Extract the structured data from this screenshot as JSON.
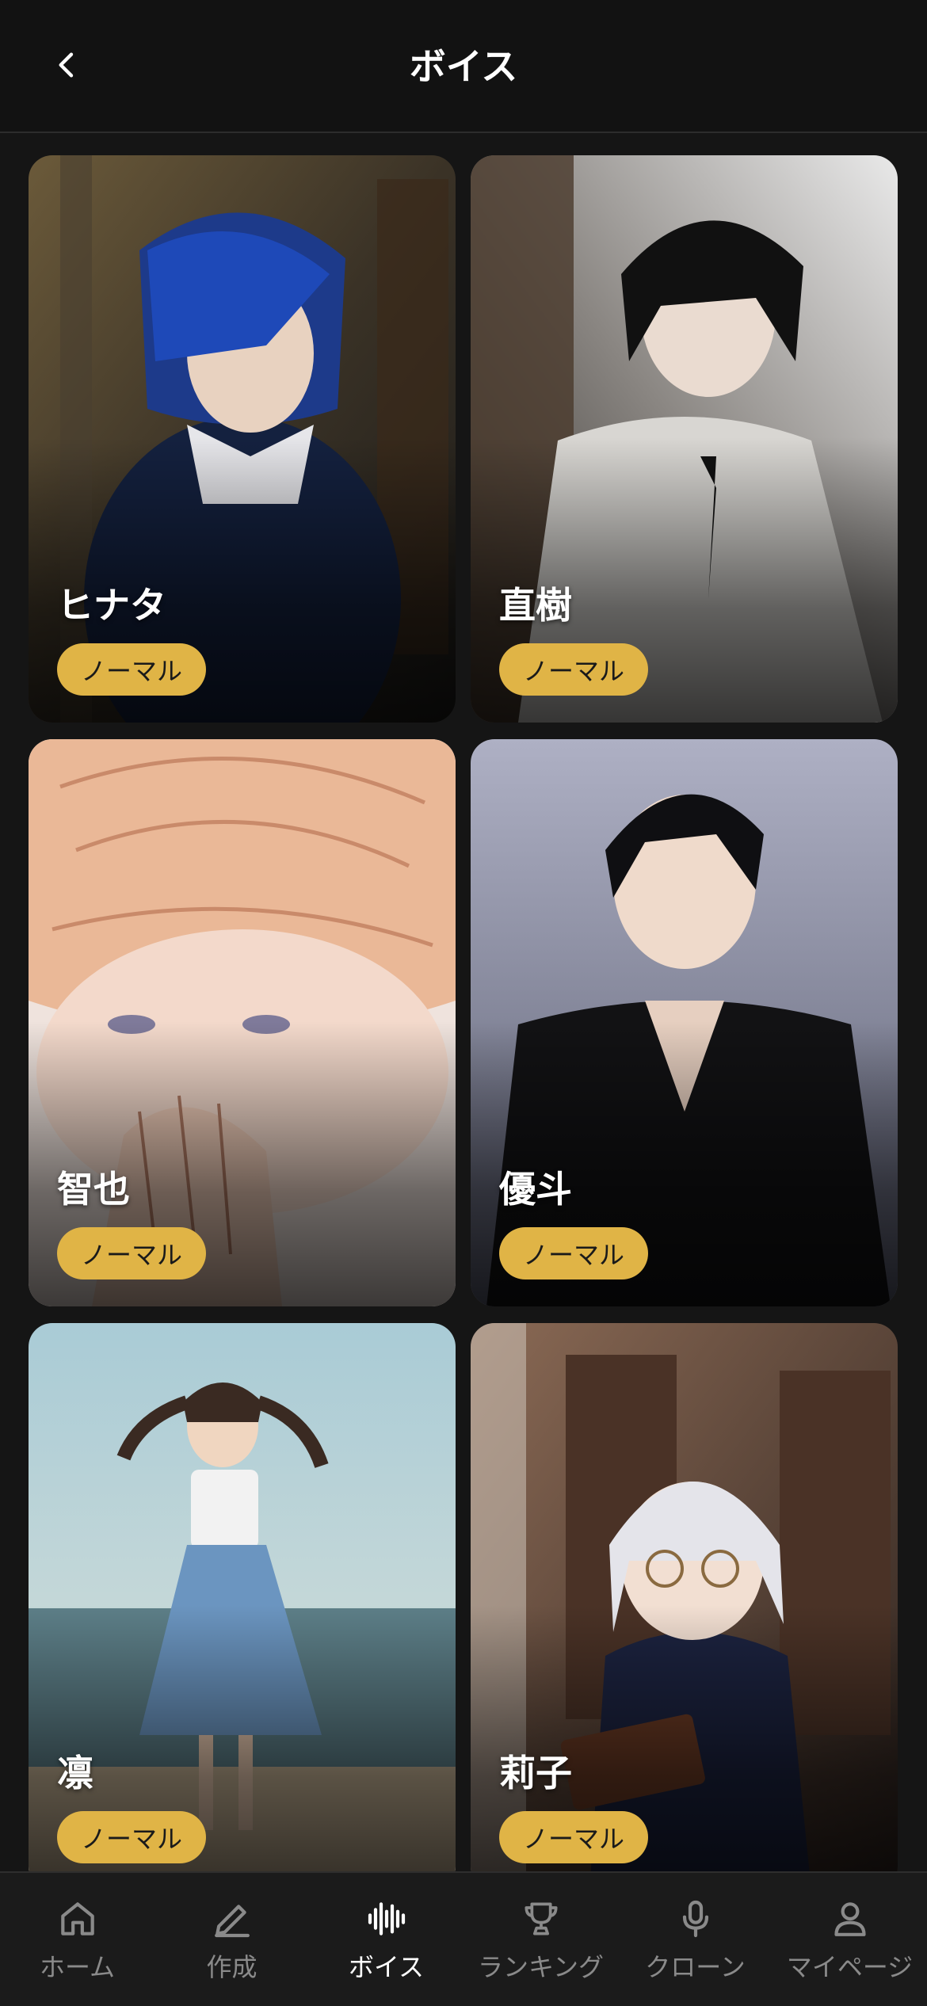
{
  "header": {
    "title": "ボイス",
    "back_icon": "chevron-left-icon"
  },
  "voices": [
    {
      "name": "ヒナタ",
      "badge": "ノーマル"
    },
    {
      "name": "直樹",
      "badge": "ノーマル"
    },
    {
      "name": "智也",
      "badge": "ノーマル"
    },
    {
      "name": "優斗",
      "badge": "ノーマル"
    },
    {
      "name": "凛",
      "badge": "ノーマル"
    },
    {
      "name": "莉子",
      "badge": "ノーマル"
    }
  ],
  "tabbar": {
    "items": [
      {
        "label": "ホーム",
        "icon": "home-icon",
        "active": false
      },
      {
        "label": "作成",
        "icon": "pencil-icon",
        "active": false
      },
      {
        "label": "ボイス",
        "icon": "waveform-icon",
        "active": true
      },
      {
        "label": "ランキング",
        "icon": "trophy-icon",
        "active": false
      },
      {
        "label": "クローン",
        "icon": "microphone-icon",
        "active": false
      },
      {
        "label": "マイページ",
        "icon": "user-icon",
        "active": false
      }
    ]
  },
  "colors": {
    "accent": "#e0b446",
    "background": "#151515",
    "header": "#121212",
    "tab_inactive": "#8a8a8a"
  }
}
